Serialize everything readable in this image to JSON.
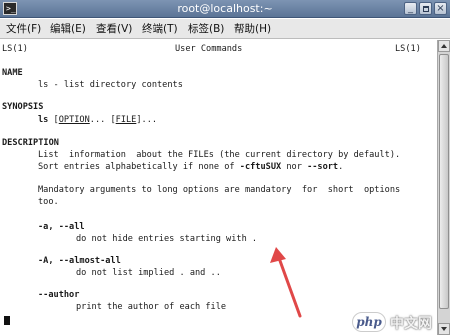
{
  "window": {
    "title": "root@localhost:~",
    "icon": "terminal-icon"
  },
  "menubar": {
    "items": [
      {
        "label": "文件(F)"
      },
      {
        "label": "编辑(E)"
      },
      {
        "label": "查看(V)"
      },
      {
        "label": "终端(T)"
      },
      {
        "label": "标签(B)"
      },
      {
        "label": "帮助(H)"
      }
    ]
  },
  "terminal": {
    "header_left": "LS(1)",
    "header_center": "User Commands",
    "header_right": "LS(1)",
    "name_heading": "NAME",
    "name_line": "ls - list directory contents",
    "synopsis_heading": "SYNOPSIS",
    "synopsis_cmd": "ls",
    "synopsis_option": "OPTION",
    "synopsis_mid": "... [",
    "synopsis_file": "FILE",
    "synopsis_end": "]...",
    "description_heading": "DESCRIPTION",
    "desc_line1": "List  information  about the FILEs (the current directory by default).",
    "desc_line2a": "Sort entries alphabetically if none of ",
    "desc_line2b": "-cftuSUX",
    "desc_line2c": " nor ",
    "desc_line2d": "--sort",
    "desc_line2e": ".",
    "desc_line3": "Mandatory arguments to long options are mandatory  for  short  options",
    "desc_line4": "too.",
    "opt_all": "-a, --all",
    "opt_all_desc": "do not hide entries starting with .",
    "opt_almost_all": "-A, --almost-all",
    "opt_almost_all_desc": "do not list implied . and ..",
    "opt_author": "--author",
    "opt_author_desc": "print the author of each file"
  },
  "watermark": {
    "php": "php",
    "cn": "中文网"
  },
  "colors": {
    "annotation_arrow": "#e04848",
    "titlebar": "#6a82a4"
  }
}
